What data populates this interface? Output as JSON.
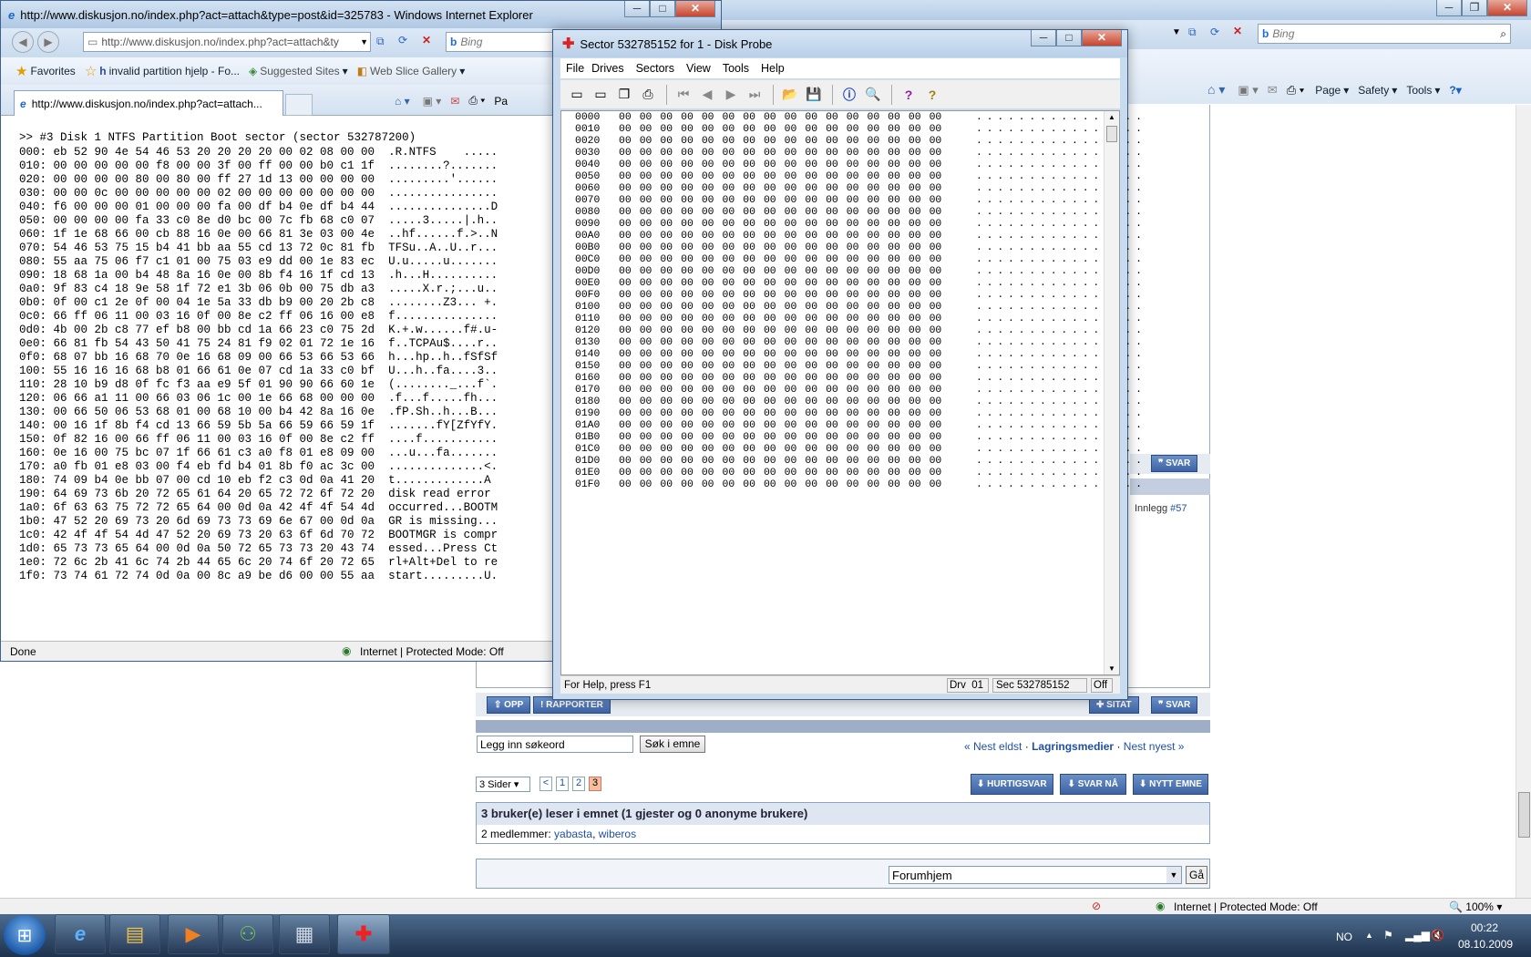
{
  "bg_browser": {
    "bing_placeholder": "Bing",
    "cmd": [
      "Page",
      "Safety",
      "Tools"
    ],
    "forum": {
      "bottom_buttons": [
        "SITAT",
        "SVAR"
      ],
      "top_buttons": [
        "OPP",
        "RAPPORTER"
      ],
      "innlegg_label": "Innlegg",
      "innlegg_num": "#57",
      "svar_top": "SVAR",
      "search_value": "Legg inn søkeord",
      "search_button": "Søk i emne",
      "nav": {
        "prev": "« Nest eldst",
        "sep": "·",
        "current": "Lagringsmedier",
        "sep2": "·",
        "next": "Nest nyest »"
      },
      "pages_select": "3 Sider",
      "pages": [
        "<",
        "1",
        "2",
        "3"
      ],
      "action_buttons": [
        "HURTIGSVAR",
        "SVAR NÅ",
        "NYTT EMNE"
      ],
      "readers_title": "3 bruker(e) leser i emnet (1 gjester og 0 anonyme brukere)",
      "members_label": "2 medlemmer:",
      "members": [
        "yabasta",
        "wiberos"
      ],
      "members_sep": ",",
      "forum_select": "Forumhjem",
      "go_button": "Gå"
    },
    "status": {
      "zone": "Internet | Protected Mode: Off",
      "zoom": "100%"
    }
  },
  "ie": {
    "title": "http://www.diskusjon.no/index.php?act=attach&type=post&id=325783 - Windows Internet Explorer",
    "address": "http://www.diskusjon.no/index.php?act=attach&ty",
    "search_placeholder": "Bing",
    "favorites": "Favorites",
    "fav_items": [
      "invalid partition hjelp - Fo...",
      "Suggested Sites",
      "Web Slice Gallery"
    ],
    "tab_title": "http://www.diskusjon.no/index.php?act=attach...",
    "page_cut": "Pa",
    "header": ">> #3 Disk 1 NTFS Partition Boot sector (sector 532787200)",
    "rows": [
      "000: eb 52 90 4e 54 46 53 20 20 20 20 00 02 08 00 00  .R.NTFS    .....",
      "010: 00 00 00 00 00 f8 00 00 3f 00 ff 00 00 b0 c1 1f  ........?.......",
      "020: 00 00 00 00 80 00 80 00 ff 27 1d 13 00 00 00 00  .........'......",
      "030: 00 00 0c 00 00 00 00 00 02 00 00 00 00 00 00 00  ................",
      "040: f6 00 00 00 01 00 00 00 fa 00 df b4 0e df b4 44  ...............D",
      "050: 00 00 00 00 fa 33 c0 8e d0 bc 00 7c fb 68 c0 07  .....3.....|.h..",
      "060: 1f 1e 68 66 00 cb 88 16 0e 00 66 81 3e 03 00 4e  ..hf......f.>..N",
      "070: 54 46 53 75 15 b4 41 bb aa 55 cd 13 72 0c 81 fb  TFSu..A..U..r...",
      "080: 55 aa 75 06 f7 c1 01 00 75 03 e9 dd 00 1e 83 ec  U.u.....u.......",
      "090: 18 68 1a 00 b4 48 8a 16 0e 00 8b f4 16 1f cd 13  .h...H..........",
      "0a0: 9f 83 c4 18 9e 58 1f 72 e1 3b 06 0b 00 75 db a3  .....X.r.;...u..",
      "0b0: 0f 00 c1 2e 0f 00 04 1e 5a 33 db b9 00 20 2b c8  ........Z3... +.",
      "0c0: 66 ff 06 11 00 03 16 0f 00 8e c2 ff 06 16 00 e8  f...............",
      "0d0: 4b 00 2b c8 77 ef b8 00 bb cd 1a 66 23 c0 75 2d  K.+.w......f#.u-",
      "0e0: 66 81 fb 54 43 50 41 75 24 81 f9 02 01 72 1e 16  f..TCPAu$....r..",
      "0f0: 68 07 bb 16 68 70 0e 16 68 09 00 66 53 66 53 66  h...hp..h..fSfSf",
      "100: 55 16 16 16 68 b8 01 66 61 0e 07 cd 1a 33 c0 bf  U...h..fa....3..",
      "110: 28 10 b9 d8 0f fc f3 aa e9 5f 01 90 90 66 60 1e  (........_...f`.",
      "120: 06 66 a1 11 00 66 03 06 1c 00 1e 66 68 00 00 00  .f...f.....fh...",
      "130: 00 66 50 06 53 68 01 00 68 10 00 b4 42 8a 16 0e  .fP.Sh..h...B...",
      "140: 00 16 1f 8b f4 cd 13 66 59 5b 5a 66 59 66 59 1f  .......fY[ZfYfY.",
      "150: 0f 82 16 00 66 ff 06 11 00 03 16 0f 00 8e c2 ff  ....f...........",
      "160: 0e 16 00 75 bc 07 1f 66 61 c3 a0 f8 01 e8 09 00  ...u...fa.......",
      "170: a0 fb 01 e8 03 00 f4 eb fd b4 01 8b f0 ac 3c 00  ..............<.",
      "180: 74 09 b4 0e bb 07 00 cd 10 eb f2 c3 0d 0a 41 20  t.............A ",
      "190: 64 69 73 6b 20 72 65 61 64 20 65 72 72 6f 72 20  disk read error ",
      "1a0: 6f 63 63 75 72 72 65 64 00 0d 0a 42 4f 4f 54 4d  occurred...BOOTM",
      "1b0: 47 52 20 69 73 20 6d 69 73 73 69 6e 67 00 0d 0a  GR is missing...",
      "1c0: 42 4f 4f 54 4d 47 52 20 69 73 20 63 6f 6d 70 72  BOOTMGR is compr",
      "1d0: 65 73 73 65 64 00 0d 0a 50 72 65 73 73 20 43 74  essed...Press Ct",
      "1e0: 72 6c 2b 41 6c 74 2b 44 65 6c 20 74 6f 20 72 65  rl+Alt+Del to re",
      "1f0: 73 74 61 72 74 0d 0a 00 8c a9 be d6 00 00 55 aa  start.........U."
    ],
    "status_done": "Done",
    "status_zone": "Internet | Protected Mode: Off"
  },
  "probe": {
    "title": "Sector 532785152 for 1 - Disk Probe",
    "menu": [
      "File",
      "Drives",
      "Sectors",
      "View",
      "Tools",
      "Help"
    ],
    "offsets": [
      "0000",
      "0010",
      "0020",
      "0030",
      "0040",
      "0050",
      "0060",
      "0070",
      "0080",
      "0090",
      "00A0",
      "00B0",
      "00C0",
      "00D0",
      "00E0",
      "00F0",
      "0100",
      "0110",
      "0120",
      "0130",
      "0140",
      "0150",
      "0160",
      "0170",
      "0180",
      "0190",
      "01A0",
      "01B0",
      "01C0",
      "01D0",
      "01E0",
      "01F0"
    ],
    "zero_bytes": "00 00 00 00 00 00 00 00 00 00 00 00 00 00 00 00",
    "zero_ascii": ". . . . . . . . . . . . . . . .",
    "status_help": "For Help, press F1",
    "status_drv": "Drv  01",
    "status_sec": "Sec 532785152",
    "status_off": "Off"
  },
  "taskbar": {
    "lang": "NO",
    "time": "00:22",
    "date": "08.10.2009"
  }
}
